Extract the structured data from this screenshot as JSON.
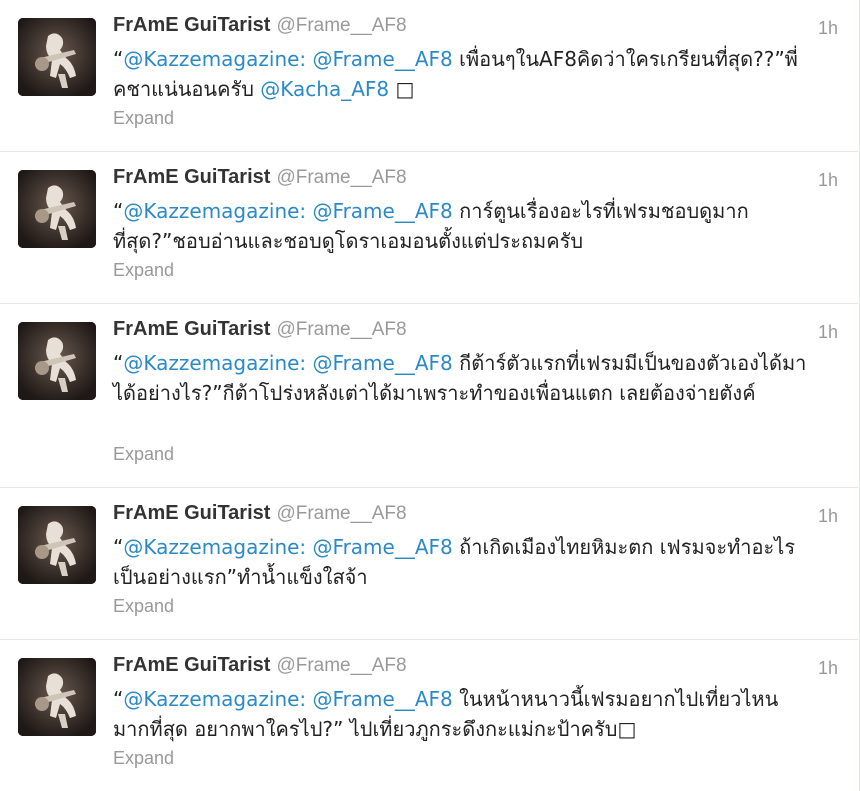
{
  "tweets": [
    {
      "fullname": "FrAmE GuiTarist",
      "username": "@Frame__AF8",
      "time": "1h",
      "expand": "Expand",
      "parts": [
        {
          "t": "“",
          "m": false
        },
        {
          "t": "@Kazzemagazine:",
          "m": true
        },
        {
          "t": " ",
          "m": false
        },
        {
          "t": "@Frame__AF8",
          "m": true
        },
        {
          "t": " เพื่อนๆในAF8คิดว่าใครเกรียนที่สุด??”พี่คชาแน่นอนครับ ",
          "m": false
        },
        {
          "t": "@Kacha_AF8",
          "m": true
        },
        {
          "t": " □",
          "m": false
        }
      ]
    },
    {
      "fullname": "FrAmE GuiTarist",
      "username": "@Frame__AF8",
      "time": "1h",
      "expand": "Expand",
      "parts": [
        {
          "t": "“",
          "m": false
        },
        {
          "t": "@Kazzemagazine:",
          "m": true
        },
        {
          "t": " ",
          "m": false
        },
        {
          "t": "@Frame__AF8",
          "m": true
        },
        {
          "t": " การ์ตูนเรื่องอะไรที่เฟรมชอบดูมากที่สุด?”ชอบอ่านและชอบดูโดราเอมอนตั้งแต่ประถมครับ",
          "m": false
        }
      ]
    },
    {
      "fullname": "FrAmE GuiTarist",
      "username": "@Frame__AF8",
      "time": "1h",
      "expand": "Expand",
      "parts": [
        {
          "t": "“",
          "m": false
        },
        {
          "t": "@Kazzemagazine:",
          "m": true
        },
        {
          "t": " ",
          "m": false
        },
        {
          "t": "@Frame__AF8",
          "m": true
        },
        {
          "t": " กีต้าร์ตัวแรกที่เฟรมมีเป็นของตัวเองได้มาได้อย่างไร?”กีต้าโปร่งหลังเต่าได้มาเพราะทำของเพื่อนแตก เลยต้องจ่ายตังค์",
          "m": false
        }
      ]
    },
    {
      "fullname": "FrAmE GuiTarist",
      "username": "@Frame__AF8",
      "time": "1h",
      "expand": "Expand",
      "parts": [
        {
          "t": "“",
          "m": false
        },
        {
          "t": "@Kazzemagazine:",
          "m": true
        },
        {
          "t": " ",
          "m": false
        },
        {
          "t": "@Frame__AF8",
          "m": true
        },
        {
          "t": " ถ้าเกิดเมืองไทยหิมะตก เฟรมจะทำอะไรเป็นอย่างแรก”ทำน้ำแข็งใสจ้า",
          "m": false
        }
      ]
    },
    {
      "fullname": "FrAmE GuiTarist",
      "username": "@Frame__AF8",
      "time": "1h",
      "expand": "Expand",
      "parts": [
        {
          "t": "“",
          "m": false
        },
        {
          "t": "@Kazzemagazine:",
          "m": true
        },
        {
          "t": " ",
          "m": false
        },
        {
          "t": "@Frame__AF8",
          "m": true
        },
        {
          "t": " ในหน้าหนาวนี้เฟรมอยากไปเที่ยวไหนมากที่สุด อยากพาใครไป?” ไปเที่ยวภูกระดึงกะแม่กะป้าครับ□",
          "m": false
        }
      ]
    }
  ]
}
